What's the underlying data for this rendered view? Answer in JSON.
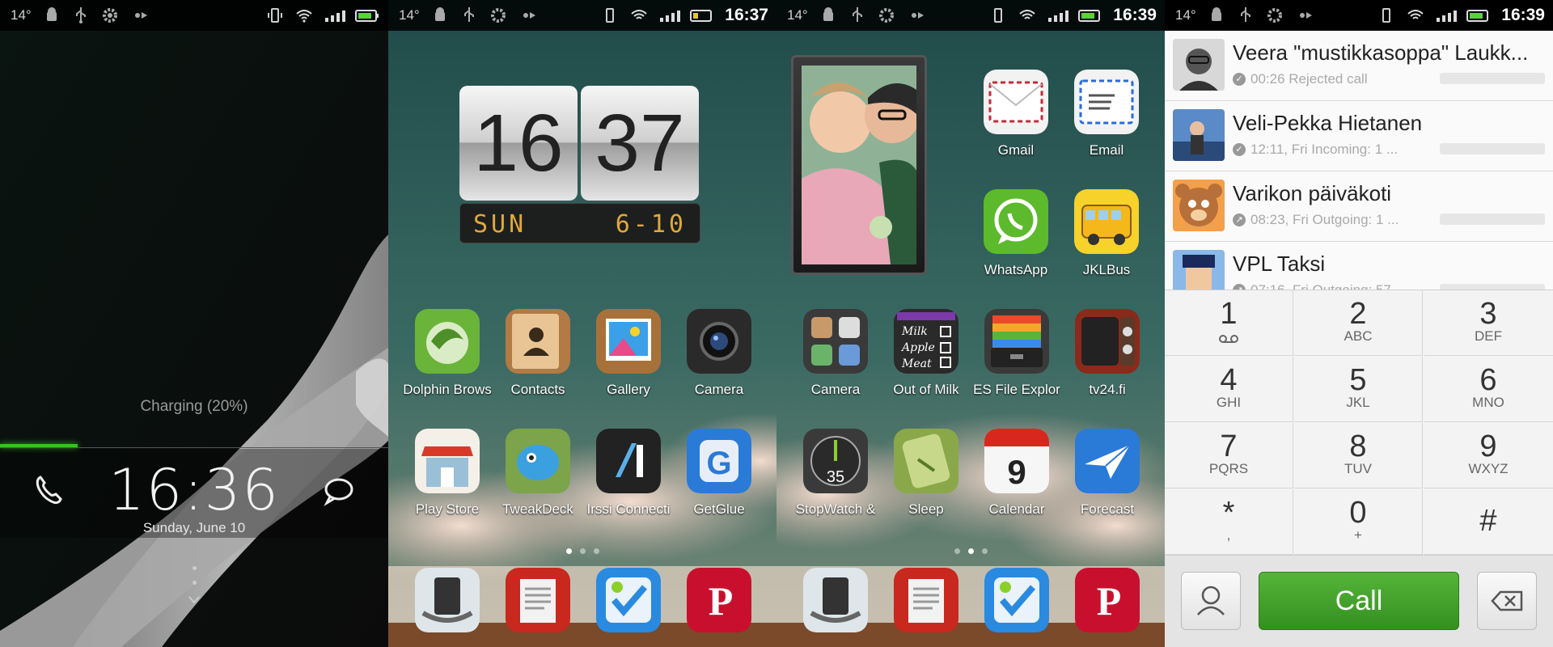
{
  "status": {
    "temperature": "14°",
    "times": [
      "16:37",
      "16:39",
      "16:39"
    ]
  },
  "lockscreen": {
    "charging_text": "Charging (20%)",
    "time": "16:36",
    "date": "Sunday, June 10",
    "charge_fraction": 0.2
  },
  "clock_widget": {
    "hour": "16",
    "minute": "37",
    "day": "SUN",
    "date": "6-10"
  },
  "home1": {
    "apps_row1": [
      "Dolphin Brows",
      "Contacts",
      "Gallery",
      "Camera"
    ],
    "apps_row2": [
      "Play Store",
      "TweakDeck",
      "Irssi Connecti",
      "GetGlue"
    ]
  },
  "home2": {
    "apps_top": [
      "Gmail",
      "Email",
      "WhatsApp",
      "JKLBus"
    ],
    "apps_row1": [
      "Camera",
      "Out of Milk",
      "ES File Explor",
      "tv24.fi"
    ],
    "apps_row2": [
      "StopWatch &",
      "Sleep",
      "Calendar",
      "Forecast"
    ],
    "calendar_day": "9",
    "stopwatch_number": "35",
    "out_of_milk_list": [
      "Milk",
      "Apple",
      "Meat"
    ]
  },
  "dialer": {
    "contacts": [
      {
        "name": "Veera \"mustikkasoppa\" Laukk...",
        "detail": "00:26 Rejected call"
      },
      {
        "name": "Veli-Pekka Hietanen",
        "detail": "12:11, Fri Incoming: 1 ..."
      },
      {
        "name": "Varikon päiväkoti",
        "detail": "08:23, Fri Outgoing: 1 ..."
      },
      {
        "name": "VPL Taksi",
        "detail": "07:16, Fri Outgoing: 57..."
      }
    ],
    "keys": [
      {
        "digit": "1",
        "letters": ""
      },
      {
        "digit": "2",
        "letters": "ABC"
      },
      {
        "digit": "3",
        "letters": "DEF"
      },
      {
        "digit": "4",
        "letters": "GHI"
      },
      {
        "digit": "5",
        "letters": "JKL"
      },
      {
        "digit": "6",
        "letters": "MNO"
      },
      {
        "digit": "7",
        "letters": "PQRS"
      },
      {
        "digit": "8",
        "letters": "TUV"
      },
      {
        "digit": "9",
        "letters": "WXYZ"
      },
      {
        "digit": "*",
        "letters": ","
      },
      {
        "digit": "0",
        "letters": "+"
      },
      {
        "digit": "#",
        "letters": ""
      }
    ],
    "call_label": "Call"
  },
  "colors": {
    "call_green": "#3c9a2b",
    "charge_green": "#3dbf2a",
    "clock_digits": "#e0a83a"
  }
}
